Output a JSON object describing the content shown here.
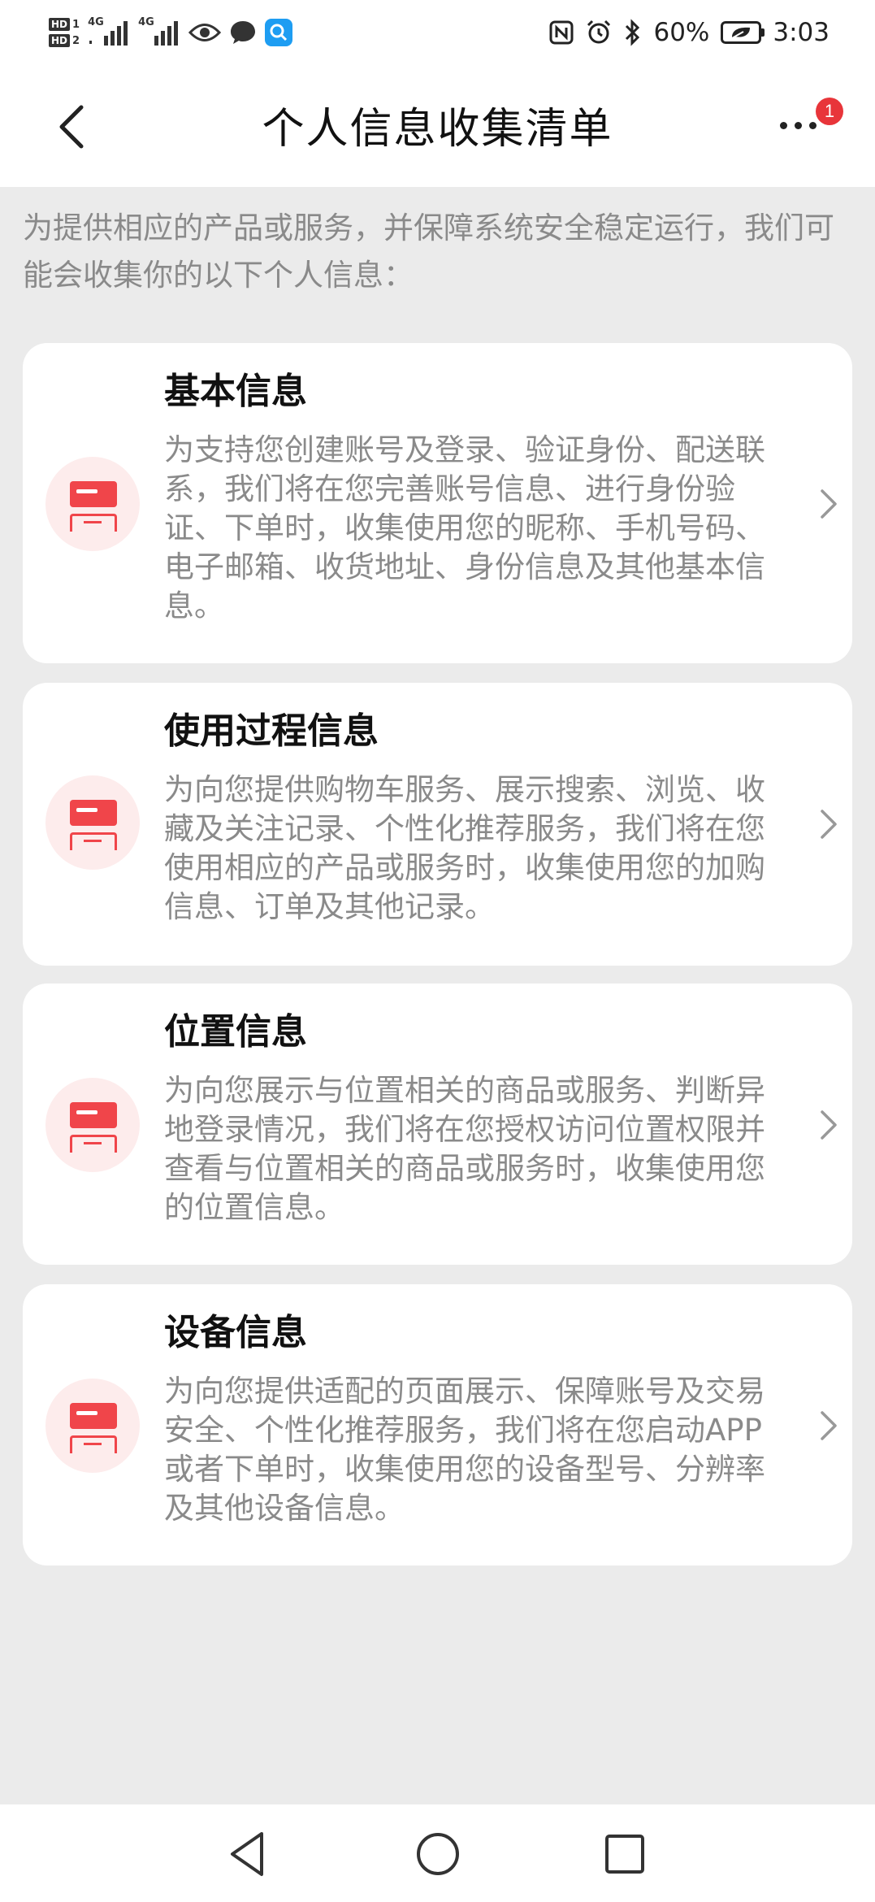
{
  "status_bar": {
    "hd1": "HD",
    "hd1_num": "1",
    "hd2": "HD",
    "hd2_num": "2",
    "network1": "4G",
    "network2": "4G",
    "battery": "60%",
    "time": "3:03"
  },
  "header": {
    "title": "个人信息收集清单",
    "badge_count": "1"
  },
  "intro": "为提供相应的产品或服务，并保障系统安全稳定运行，我们可能会收集你的以下个人信息：",
  "cards": [
    {
      "title": "基本信息",
      "desc": "为支持您创建账号及登录、验证身份、配送联系，我们将在您完善账号信息、进行身份验证、下单时，收集使用您的昵称、手机号码、电子邮箱、收货地址、身份信息及其他基本信息。"
    },
    {
      "title": "使用过程信息",
      "desc": "为向您提供购物车服务、展示搜索、浏览、收藏及关注记录、个性化推荐服务，我们将在您使用相应的产品或服务时，收集使用您的加购信息、订单及其他记录。"
    },
    {
      "title": "位置信息",
      "desc": "为向您展示与位置相关的商品或服务、判断异地登录情况，我们将在您授权访问位置权限并查看与位置相关的商品或服务时，收集使用您的位置信息。"
    },
    {
      "title": "设备信息",
      "desc": "为向您提供适配的页面展示、保障账号及交易安全、个性化推荐服务，我们将在您启动APP或者下单时，收集使用您的设备型号、分辨率及其他设备信息。"
    }
  ],
  "icons": {
    "back": "chevron-left-icon",
    "more": "more-dots-icon",
    "card": "form-icon",
    "card_arrow": "chevron-right-icon",
    "nav_back": "triangle-back-icon",
    "nav_home": "circle-home-icon",
    "nav_recent": "square-recent-icon"
  },
  "colors": {
    "accent": "#f0454a",
    "badge": "#e8353a",
    "background": "#ebebeb",
    "secondary_text": "#8a8a8a"
  }
}
